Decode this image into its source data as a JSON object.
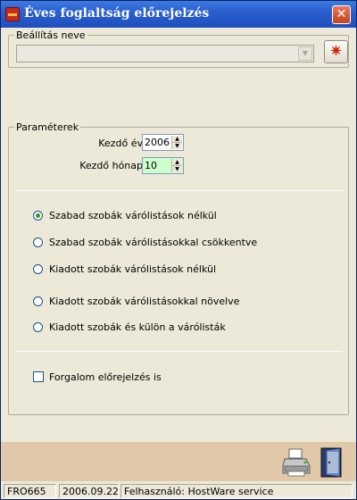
{
  "window": {
    "title": "Éves foglaltság előrejelzés",
    "close_label": "✕"
  },
  "settings": {
    "group_label": "Beállítás neve",
    "combo_value": "",
    "star_glyph": "✷"
  },
  "params": {
    "group_label": "Paraméterek",
    "start_year_label": "Kezdő év",
    "start_year_value": "2006",
    "start_month_label": "Kezdő hónap",
    "start_month_value": "10"
  },
  "options": {
    "selected": 0,
    "items": [
      "Szabad szobák várólistások nélkül",
      "Szabad szobák várólistásokkal csökkentve",
      "Kiadott szobák várólistások nélkül",
      "Kiadott szobák várólistásokkal növelve",
      "Kiadott szobák és külön a várólisták"
    ]
  },
  "forecast_checkbox": {
    "label": "Forgalom előrejelzés is",
    "checked": false
  },
  "statusbar": {
    "code": "FRO665",
    "date": "2006.09.22",
    "user": "Felhasználó: HostWare service"
  },
  "colors": {
    "titlebar": "#2a5fd0",
    "month_field_bg": "#ccffcc",
    "toolbar_strip": "#e0c8a8"
  },
  "icons": {
    "printer": "printer-icon",
    "exit": "exit-door-icon",
    "star": "star-icon"
  }
}
